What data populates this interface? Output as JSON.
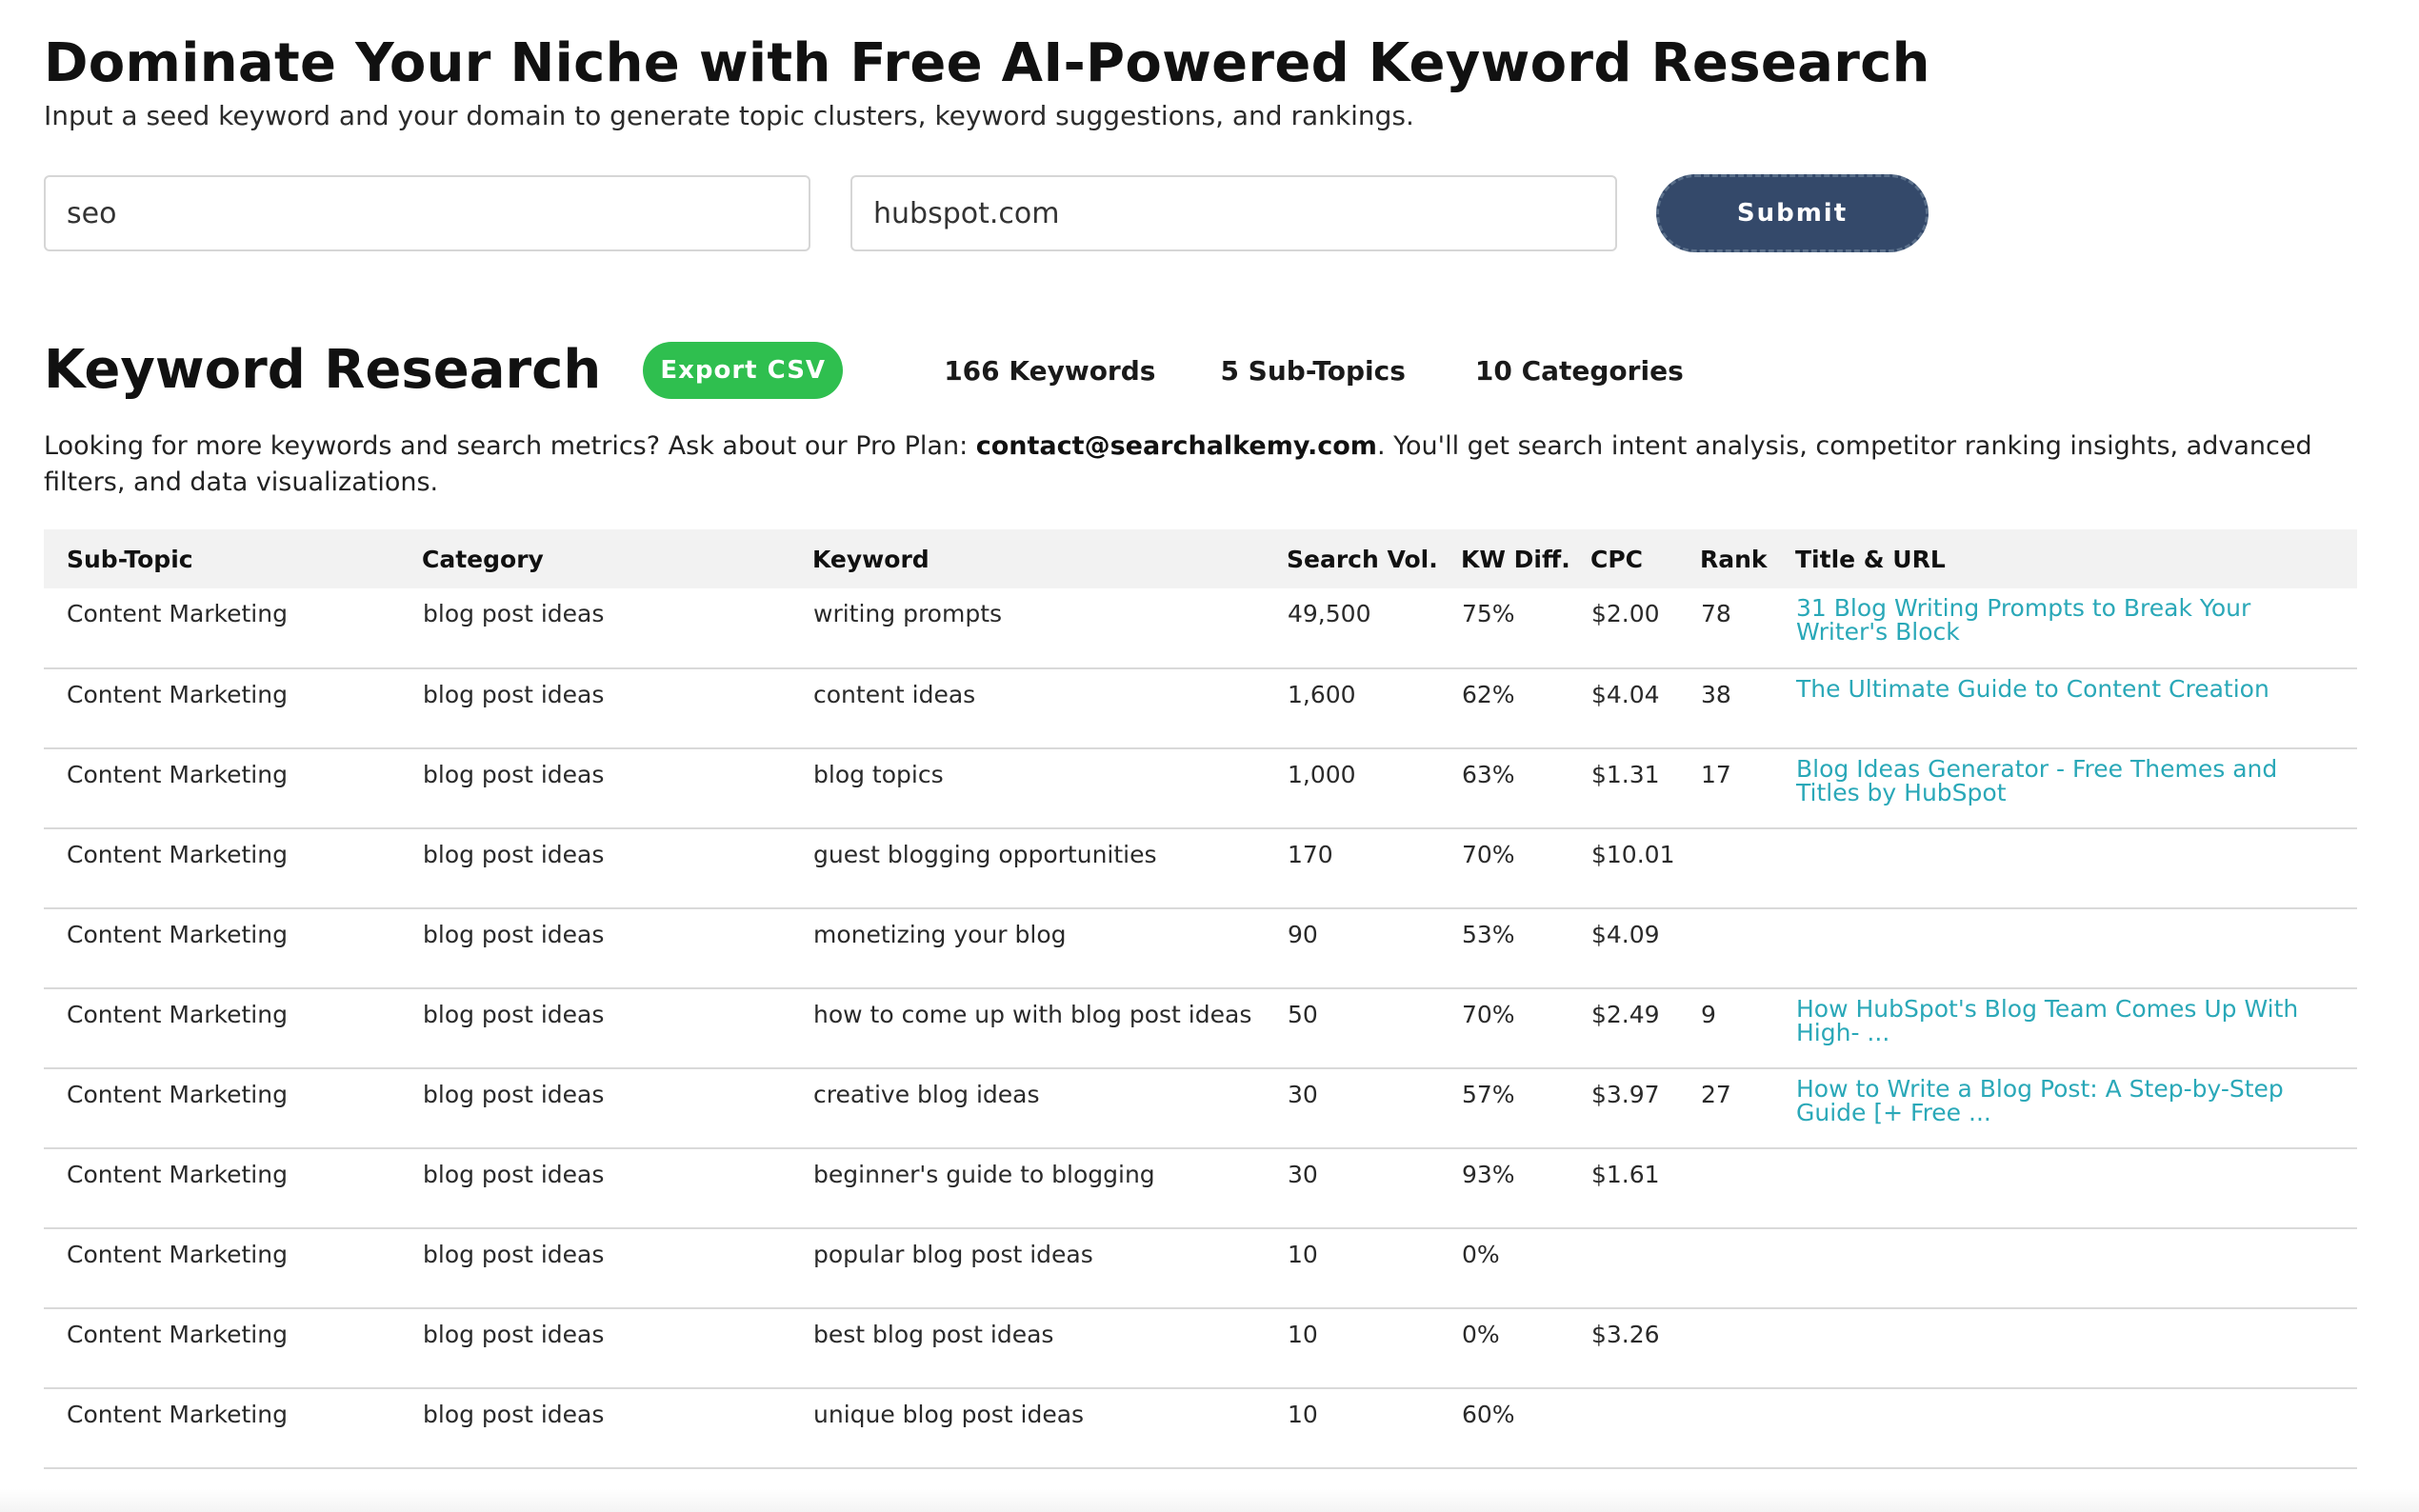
{
  "hero": {
    "title": "Dominate Your Niche with Free AI-Powered Keyword Research",
    "subtitle": "Input a seed keyword and your domain to generate topic clusters, keyword suggestions, and rankings."
  },
  "form": {
    "seed_value": "seo",
    "domain_value": "hubspot.com",
    "submit_label": "Submit"
  },
  "results": {
    "title": "Keyword Research",
    "export_label": "Export CSV",
    "stats": {
      "keywords": "166 Keywords",
      "subtopics": "5 Sub-Topics",
      "categories": "10 Categories"
    },
    "promo": {
      "before": "Looking for more keywords and search metrics? Ask about our Pro Plan: ",
      "email": "contact@searchalkemy.com",
      "after": ". You'll get search intent analysis, competitor ranking insights, advanced filters, and data visualizations."
    }
  },
  "table": {
    "columns": [
      "Sub-Topic",
      "Category",
      "Keyword",
      "Search Vol.",
      "KW Diff.",
      "CPC",
      "Rank",
      "Title & URL"
    ],
    "rows": [
      {
        "subtopic": "Content Marketing",
        "category": "blog post ideas",
        "keyword": "writing prompts",
        "volume": "49,500",
        "difficulty": "75%",
        "cpc": "$2.00",
        "rank": "78",
        "title": "31 Blog Writing Prompts to Break Your Writer's Block"
      },
      {
        "subtopic": "Content Marketing",
        "category": "blog post ideas",
        "keyword": "content ideas",
        "volume": "1,600",
        "difficulty": "62%",
        "cpc": "$4.04",
        "rank": "38",
        "title": "The Ultimate Guide to Content Creation"
      },
      {
        "subtopic": "Content Marketing",
        "category": "blog post ideas",
        "keyword": "blog topics",
        "volume": "1,000",
        "difficulty": "63%",
        "cpc": "$1.31",
        "rank": "17",
        "title": "Blog Ideas Generator - Free Themes and Titles by HubSpot"
      },
      {
        "subtopic": "Content Marketing",
        "category": "blog post ideas",
        "keyword": "guest blogging opportunities",
        "volume": "170",
        "difficulty": "70%",
        "cpc": "$10.01",
        "rank": "",
        "title": ""
      },
      {
        "subtopic": "Content Marketing",
        "category": "blog post ideas",
        "keyword": "monetizing your blog",
        "volume": "90",
        "difficulty": "53%",
        "cpc": "$4.09",
        "rank": "",
        "title": ""
      },
      {
        "subtopic": "Content Marketing",
        "category": "blog post ideas",
        "keyword": "how to come up with blog post ideas",
        "volume": "50",
        "difficulty": "70%",
        "cpc": "$2.49",
        "rank": "9",
        "title": "How HubSpot's Blog Team Comes Up With High- ..."
      },
      {
        "subtopic": "Content Marketing",
        "category": "blog post ideas",
        "keyword": "creative blog ideas",
        "volume": "30",
        "difficulty": "57%",
        "cpc": "$3.97",
        "rank": "27",
        "title": "How to Write a Blog Post: A Step-by-Step Guide [+ Free ..."
      },
      {
        "subtopic": "Content Marketing",
        "category": "blog post ideas",
        "keyword": "beginner's guide to blogging",
        "volume": "30",
        "difficulty": "93%",
        "cpc": "$1.61",
        "rank": "",
        "title": ""
      },
      {
        "subtopic": "Content Marketing",
        "category": "blog post ideas",
        "keyword": "popular blog post ideas",
        "volume": "10",
        "difficulty": "0%",
        "cpc": "",
        "rank": "",
        "title": ""
      },
      {
        "subtopic": "Content Marketing",
        "category": "blog post ideas",
        "keyword": "best blog post ideas",
        "volume": "10",
        "difficulty": "0%",
        "cpc": "$3.26",
        "rank": "",
        "title": ""
      },
      {
        "subtopic": "Content Marketing",
        "category": "blog post ideas",
        "keyword": "unique blog post ideas",
        "volume": "10",
        "difficulty": "60%",
        "cpc": "",
        "rank": "",
        "title": ""
      }
    ]
  }
}
